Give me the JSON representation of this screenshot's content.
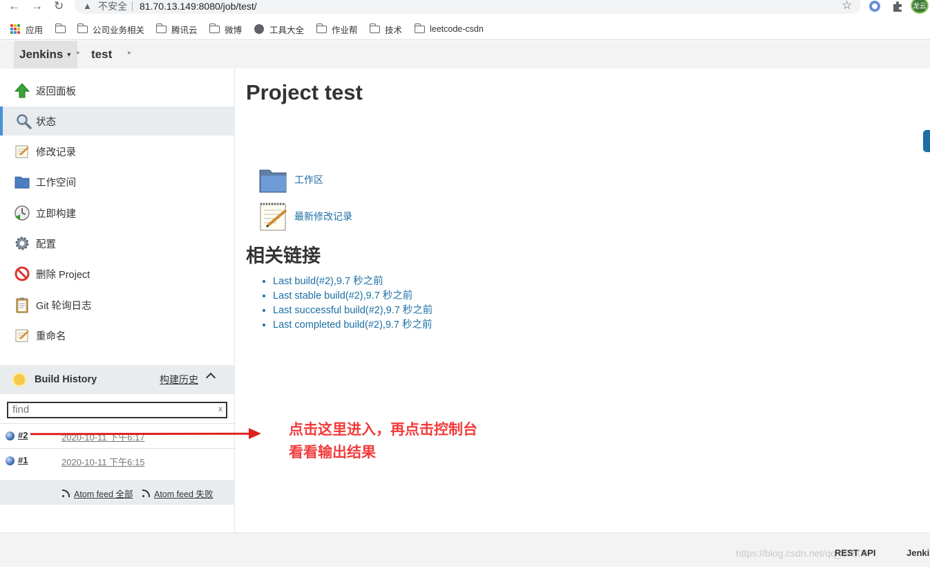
{
  "browser": {
    "insecure_label": "不安全",
    "url": "81.70.13.149:8080/job/test/",
    "avatar_text": "龙云",
    "bookmarks": [
      {
        "label": "应用",
        "icon": "apps-grid-icon"
      },
      {
        "label": "",
        "icon": "folder-icon"
      },
      {
        "label": "公司业务相关",
        "icon": "folder-icon"
      },
      {
        "label": "腾讯云",
        "icon": "folder-icon"
      },
      {
        "label": "微博",
        "icon": "folder-icon"
      },
      {
        "label": "工具大全",
        "icon": "globe-icon"
      },
      {
        "label": "作业帮",
        "icon": "folder-icon"
      },
      {
        "label": "技术",
        "icon": "folder-icon"
      },
      {
        "label": "leetcode-csdn",
        "icon": "folder-icon"
      }
    ]
  },
  "breadcrumb": {
    "home": "Jenkins",
    "job": "test"
  },
  "sidebar": {
    "tasks": [
      {
        "label": "返回面板",
        "icon": "up-arrow-icon"
      },
      {
        "label": "状态",
        "icon": "magnifier-icon"
      },
      {
        "label": "修改记录",
        "icon": "notepad-icon"
      },
      {
        "label": "工作空间",
        "icon": "folder-icon"
      },
      {
        "label": "立即构建",
        "icon": "clock-build-icon"
      },
      {
        "label": "配置",
        "icon": "gear-icon"
      },
      {
        "label": "删除 Project",
        "icon": "no-entry-icon"
      },
      {
        "label": "Git 轮询日志",
        "icon": "clipboard-icon"
      },
      {
        "label": "重命名",
        "icon": "notepad-icon"
      }
    ],
    "build_history": {
      "title": "Build History",
      "trend": "构建历史",
      "find_placeholder": "find",
      "clear": "x",
      "builds": [
        {
          "number": "#2",
          "date": "2020-10-11 下午6:17"
        },
        {
          "number": "#1",
          "date": "2020-10-11 下午6:15"
        }
      ],
      "atom_all": "Atom feed 全部",
      "atom_failed": "Atom feed 失败"
    }
  },
  "main": {
    "title": "Project test",
    "workspace_link": "工作区",
    "changes_link": "最新修改记录",
    "related_title": "相关链接",
    "links": [
      "Last build(#2),9.7 秒之前",
      "Last stable build(#2),9.7 秒之前",
      "Last successful build(#2),9.7 秒之前",
      "Last completed build(#2),9.7 秒之前"
    ],
    "annotation": "点击这里进入，再点击控制台看看输出结果"
  },
  "footer": {
    "rest_api": "REST API",
    "jenkins": "Jenki",
    "watermark": "https://blog.csdn.net/qq_37509"
  },
  "colors": {
    "link": "#1c6ea4",
    "annotation": "#f23b3b",
    "active_border": "#4a90d9"
  }
}
